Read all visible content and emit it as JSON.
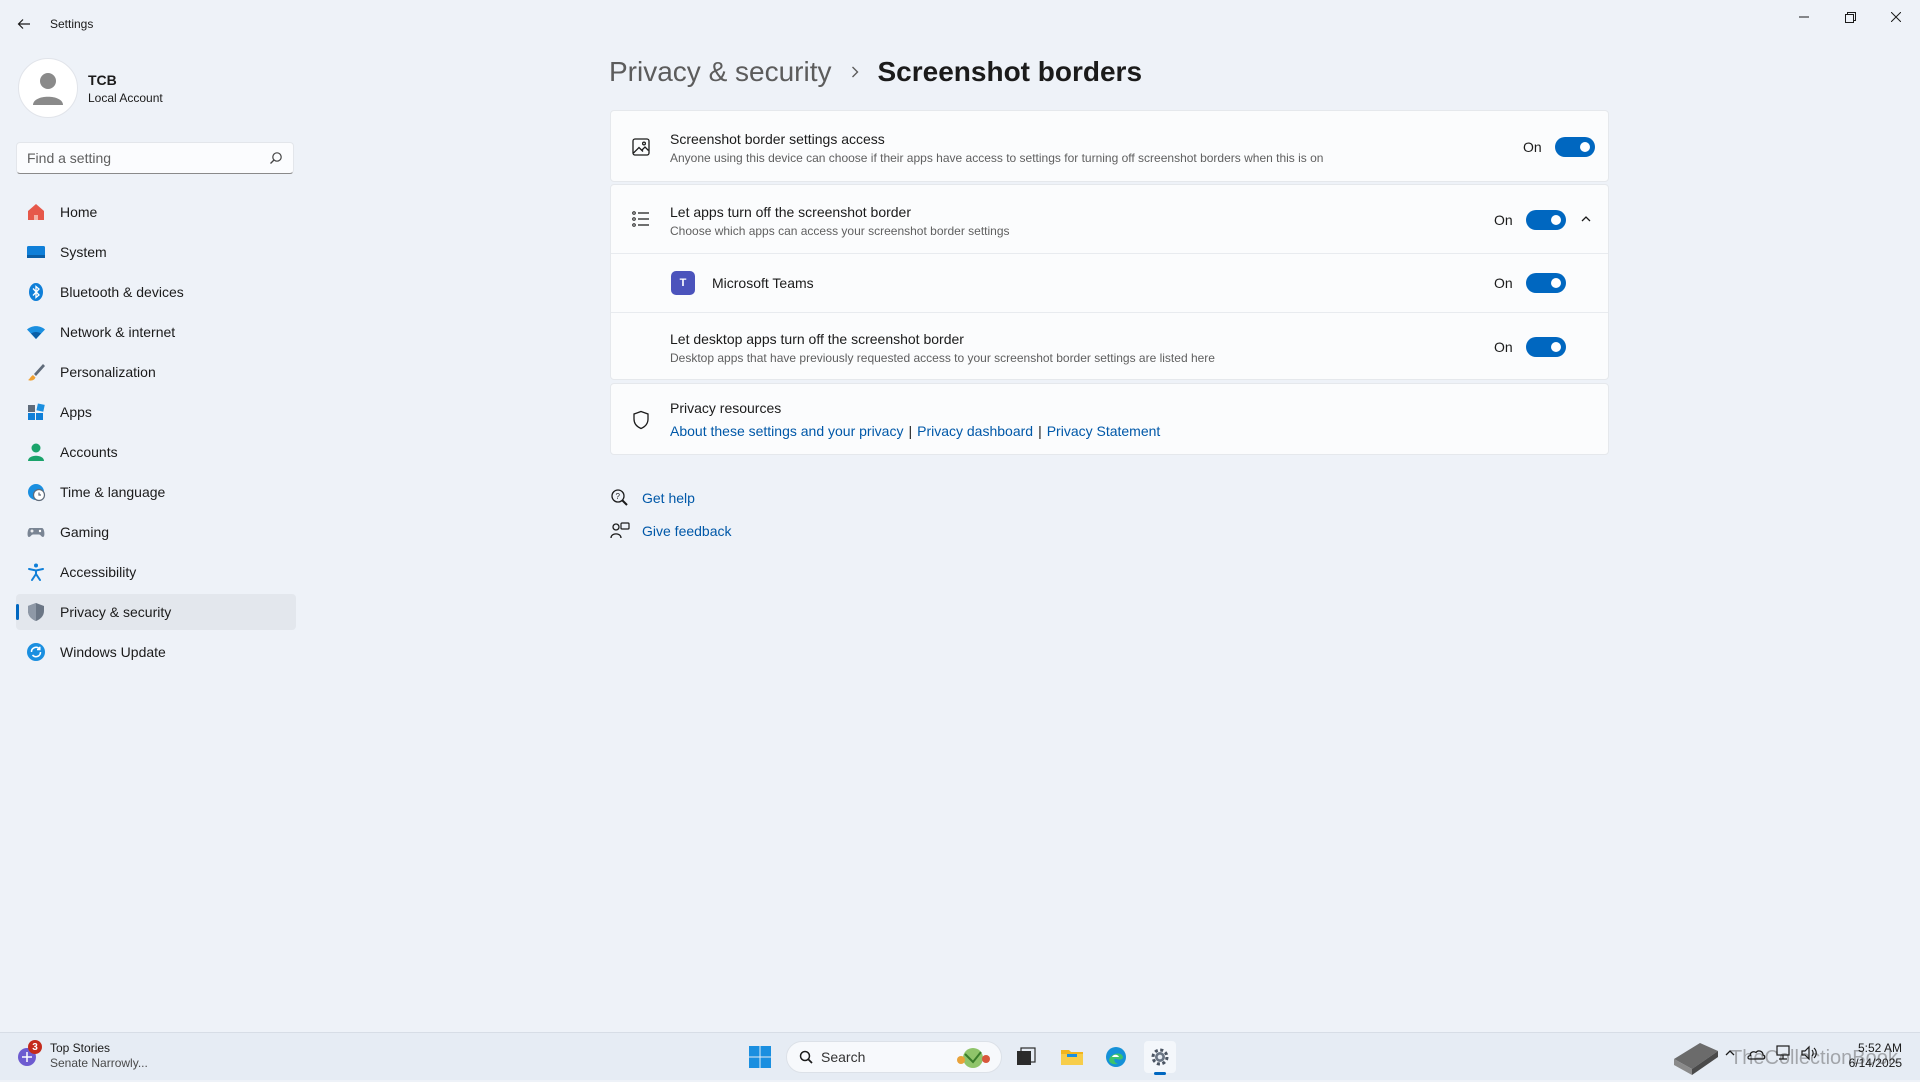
{
  "window": {
    "title": "Settings"
  },
  "profile": {
    "name": "TCB",
    "account_type": "Local Account"
  },
  "search": {
    "placeholder": "Find a setting"
  },
  "nav": {
    "items": [
      {
        "label": "Home",
        "icon": "home-icon"
      },
      {
        "label": "System",
        "icon": "system-icon"
      },
      {
        "label": "Bluetooth & devices",
        "icon": "bluetooth-icon"
      },
      {
        "label": "Network & internet",
        "icon": "wifi-icon"
      },
      {
        "label": "Personalization",
        "icon": "brush-icon"
      },
      {
        "label": "Apps",
        "icon": "apps-icon"
      },
      {
        "label": "Accounts",
        "icon": "person-icon"
      },
      {
        "label": "Time & language",
        "icon": "clock-globe-icon"
      },
      {
        "label": "Gaming",
        "icon": "gamepad-icon"
      },
      {
        "label": "Accessibility",
        "icon": "accessibility-icon"
      },
      {
        "label": "Privacy & security",
        "icon": "shield-icon",
        "active": true
      },
      {
        "label": "Windows Update",
        "icon": "update-icon"
      }
    ]
  },
  "breadcrumb": {
    "parent": "Privacy & security",
    "current": "Screenshot borders"
  },
  "settings": {
    "access": {
      "title": "Screenshot border settings access",
      "desc": "Anyone using this device can choose if their apps have access to settings for turning off screenshot borders when this is on",
      "state": "On"
    },
    "let_apps": {
      "title": "Let apps turn off the screenshot border",
      "desc": "Choose which apps can access your screenshot border settings",
      "state": "On"
    },
    "teams": {
      "name": "Microsoft Teams",
      "state": "On",
      "tile_letter": "T"
    },
    "desktop_apps": {
      "title": "Let desktop apps turn off the screenshot border",
      "desc": "Desktop apps that have previously requested access to your screenshot border settings are listed here",
      "state": "On"
    }
  },
  "privacy_resources": {
    "title": "Privacy resources",
    "links": [
      "About these settings and your privacy",
      "Privacy dashboard",
      "Privacy Statement"
    ],
    "separator": "|"
  },
  "help": {
    "get_help": "Get help",
    "give_feedback": "Give feedback"
  },
  "taskbar": {
    "news_title": "Top Stories",
    "news_sub": "Senate Narrowly...",
    "news_badge": "3",
    "search_label": "Search",
    "time": "5:52 AM",
    "date": "6/14/2025",
    "watermark": "TheCollectionBook"
  },
  "colors": {
    "accent": "#0067c0",
    "link": "#0058a8",
    "teams": "#4b53bc"
  }
}
